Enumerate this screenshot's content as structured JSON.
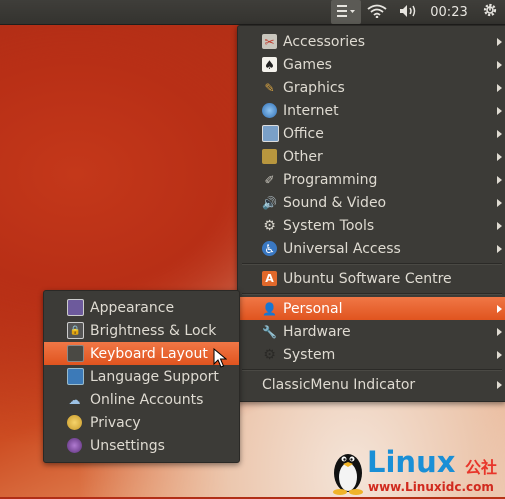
{
  "panel": {
    "clock": "00:23",
    "icons": [
      "menu-icon",
      "wifi-icon",
      "volume-icon",
      "power-gear-icon"
    ]
  },
  "main_menu": {
    "items": [
      {
        "label": "Accessories",
        "icon": "accessories-icon",
        "has_submenu": true
      },
      {
        "label": "Games",
        "icon": "games-icon",
        "has_submenu": true
      },
      {
        "label": "Graphics",
        "icon": "graphics-icon",
        "has_submenu": true
      },
      {
        "label": "Internet",
        "icon": "internet-icon",
        "has_submenu": true
      },
      {
        "label": "Office",
        "icon": "office-icon",
        "has_submenu": true
      },
      {
        "label": "Other",
        "icon": "other-icon",
        "has_submenu": true
      },
      {
        "label": "Programming",
        "icon": "programming-icon",
        "has_submenu": true
      },
      {
        "label": "Sound & Video",
        "icon": "sound-video-icon",
        "has_submenu": true
      },
      {
        "label": "System Tools",
        "icon": "system-tools-icon",
        "has_submenu": true
      },
      {
        "label": "Universal Access",
        "icon": "universal-access-icon",
        "has_submenu": true
      }
    ],
    "software_centre": "Ubuntu Software Centre",
    "personal": "Personal",
    "hardware": "Hardware",
    "system": "System",
    "classic_menu": "ClassicMenu Indicator"
  },
  "sub_menu": {
    "items": [
      {
        "label": "Appearance",
        "icon": "appearance-icon"
      },
      {
        "label": "Brightness & Lock",
        "icon": "brightness-lock-icon"
      },
      {
        "label": "Keyboard Layout",
        "icon": "keyboard-icon"
      },
      {
        "label": "Language Support",
        "icon": "language-icon"
      },
      {
        "label": "Online Accounts",
        "icon": "online-accounts-icon"
      },
      {
        "label": "Privacy",
        "icon": "privacy-icon"
      },
      {
        "label": "Unsettings",
        "icon": "unsettings-icon"
      }
    ],
    "highlighted": "Keyboard Layout"
  },
  "watermark": {
    "brand": "Linux",
    "brand_cn": "公社",
    "url": "www.Linuxidc.com"
  },
  "colors": {
    "highlight": "#e9622f",
    "menu_bg": "#3c3b37",
    "panel_bg": "#3a3935"
  }
}
